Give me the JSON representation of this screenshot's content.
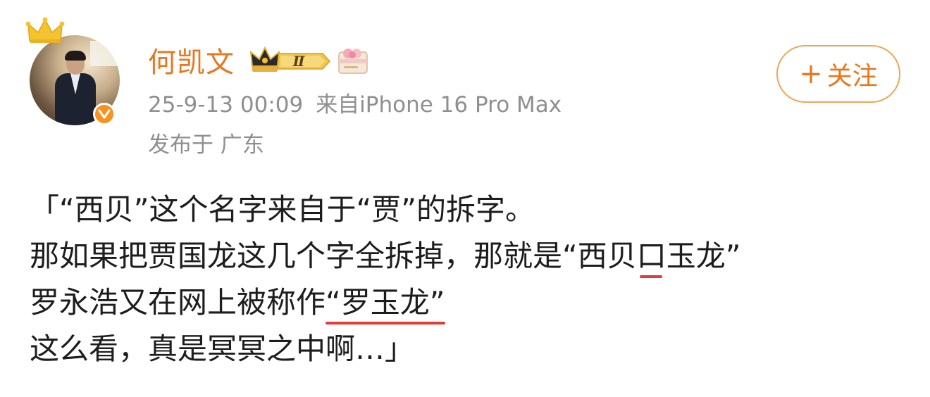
{
  "user": {
    "name": "何凯文",
    "vip_level": "Ⅱ",
    "accent_color": "#e8771f",
    "verified_color": "#f7921e"
  },
  "post": {
    "timestamp": "25-9-13 00:09",
    "source": "来自iPhone 16 Pro Max",
    "location": "发布于 广东",
    "lines": [
      [
        "「“西贝”这个名字来自于“贾”的拆字。"
      ],
      [
        "那如果把贾国龙这几个字全拆掉，那就是“西贝",
        "口",
        "玉龙”"
      ],
      [
        "罗永浩又在网上被称作",
        "“罗玉龙”"
      ],
      [
        "这么看，真是冥冥之中啊…」"
      ]
    ]
  },
  "follow": {
    "plus": "+",
    "label": "关注"
  },
  "icons": {
    "crown": "crown-icon",
    "verified": "verified-v-icon",
    "vip": "vip-crown-badge-icon",
    "gift": "gift-card-icon"
  },
  "annotation_color": "#e53b3b"
}
